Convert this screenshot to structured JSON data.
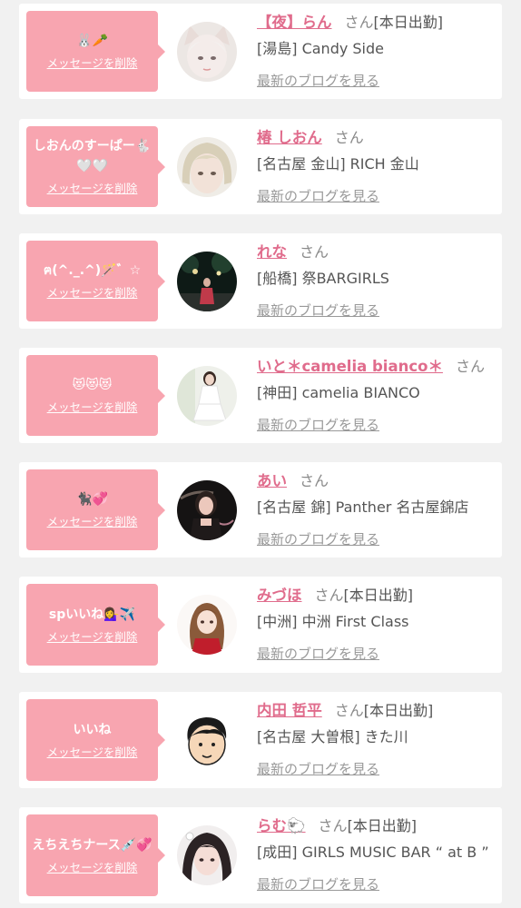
{
  "delete_label": "メッセージを削除",
  "blog_label": "最新のブログを見る",
  "san_label": "さん",
  "colors": {
    "bubble": "#f8a5b0",
    "name": "#e06c8c",
    "background": "#f1f1f1"
  },
  "entries": [
    {
      "message": "🐰🥕",
      "name": "【夜】らん",
      "duty": "[本日出勤]",
      "shop": "[湯島] Candy Side"
    },
    {
      "message": "しおんのすーぱー🐇🤍🤍",
      "name": "椿 しおん",
      "duty": "",
      "shop": "[名古屋 金山] RICH 金山"
    },
    {
      "message": "ฅ(^._.^)🪄゛☆",
      "name": "れな",
      "duty": "",
      "shop": "[船橋] 祭BARGIRLS"
    },
    {
      "message": "😻😻😻",
      "name": "いと＊camelia bianco＊",
      "duty": "",
      "shop": "[神田] camelia BIANCO"
    },
    {
      "message": "🐈‍⬛💞",
      "name": "あい",
      "duty": "",
      "shop": "[名古屋 錦] Panther 名古屋錦店"
    },
    {
      "message": "spいいね💁‍♀️✈️",
      "name": "みづほ",
      "duty": "[本日出勤]",
      "shop": "[中洲] 中洲 First Class"
    },
    {
      "message": "いいね",
      "name": "内田 哲平",
      "duty": "[本日出勤]",
      "shop": "[名古屋 大曽根] きた川"
    },
    {
      "message": "えちえちナース💉💞",
      "name": "らむ🐑",
      "duty": "[本日出勤]",
      "shop": "[成田] GIRLS MUSIC BAR “ at B ”"
    }
  ]
}
